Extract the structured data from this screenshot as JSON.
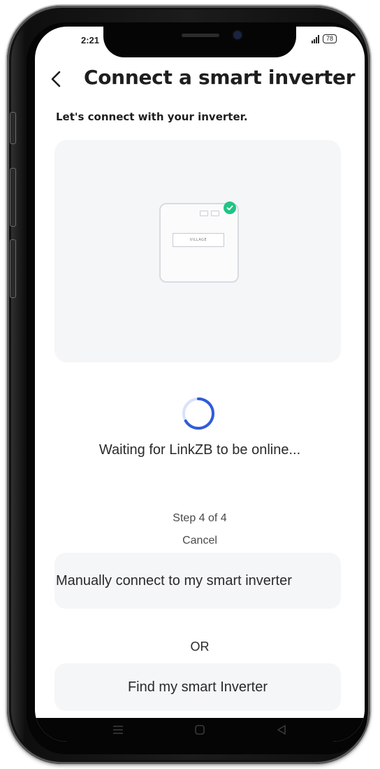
{
  "status_bar": {
    "time": "2:21",
    "battery": "78"
  },
  "header": {
    "back_icon": "chevron-left-icon",
    "title": "Connect a smart inverter"
  },
  "subtitle": "Let's connect with your inverter.",
  "illustration": {
    "device_label": "VILLAGE",
    "status_icon": "check-circle-icon",
    "status_color": "#20c485"
  },
  "progress": {
    "spinner_color": "#2f5cd8",
    "message": "Waiting for LinkZB to be online...",
    "step": "Step 4 of 4",
    "cancel_label": "Cancel"
  },
  "actions": {
    "manual_label": "Manually connect to my smart inverter",
    "or_label": "OR",
    "find_label": "Find my smart Inverter"
  },
  "navbar": {
    "menu_icon": "menu-icon",
    "home_icon": "home-icon",
    "back_icon": "back-triangle-icon"
  }
}
